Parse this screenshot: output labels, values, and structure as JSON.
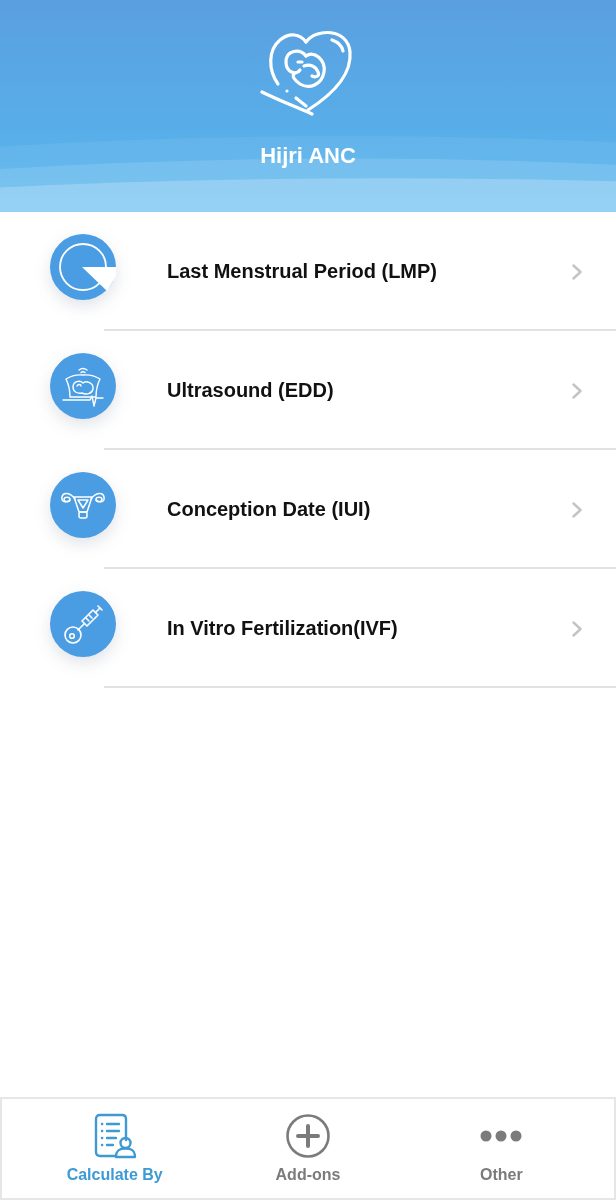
{
  "header": {
    "title": "Hijri ANC"
  },
  "menu": [
    {
      "kind": "lmp",
      "label": "Last Menstrual Period (LMP)"
    },
    {
      "kind": "ultrasound",
      "label": "Ultrasound (EDD)"
    },
    {
      "kind": "conception",
      "label": "Conception Date (IUI)"
    },
    {
      "kind": "ivf",
      "label": "In Vitro Fertilization(IVF)"
    }
  ],
  "tab_bar": [
    {
      "kind": "calculate",
      "label": "Calculate By",
      "selected": true
    },
    {
      "kind": "addons",
      "label": "Add-ons",
      "selected": false
    },
    {
      "kind": "other",
      "label": "Other",
      "selected": false
    }
  ]
}
